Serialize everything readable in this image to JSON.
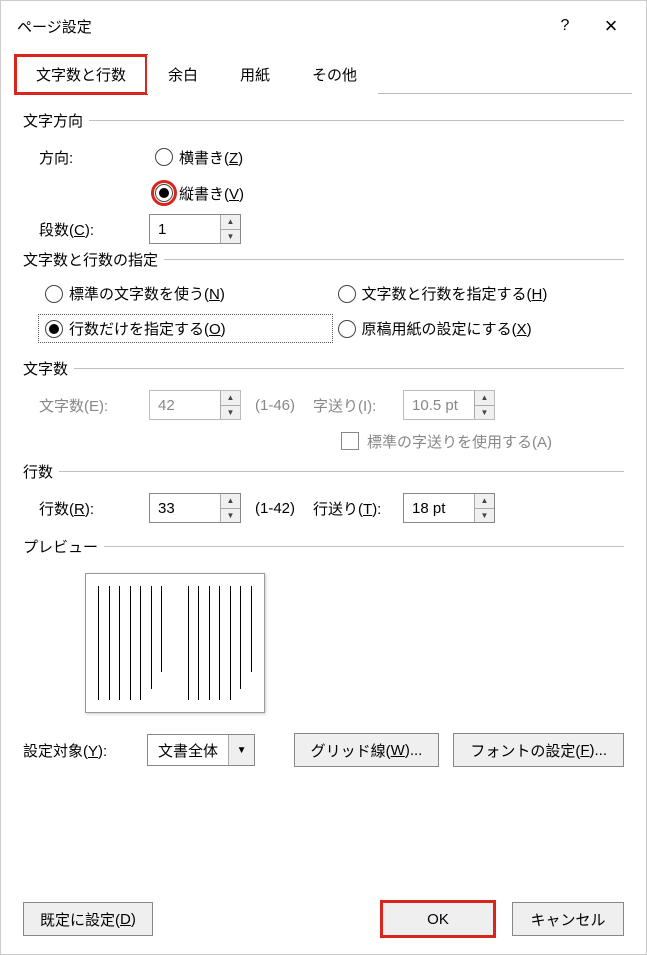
{
  "title": "ページ設定",
  "titlebar": {
    "help": "?",
    "close": "×"
  },
  "tabs": [
    {
      "label": "文字数と行数",
      "active": true,
      "highlighted": true
    },
    {
      "label": "余白",
      "active": false
    },
    {
      "label": "用紙",
      "active": false
    },
    {
      "label": "その他",
      "active": false
    }
  ],
  "direction": {
    "group": "文字方向",
    "label": "方向:",
    "horizontal": {
      "text": "横書き(",
      "key": "Z",
      "after": ")",
      "selected": false
    },
    "vertical": {
      "text": "縦書き(",
      "key": "V",
      "after": ")",
      "selected": true,
      "highlighted": true
    }
  },
  "columns": {
    "label_pre": "段数(",
    "key": "C",
    "label_post": "):",
    "value": "1"
  },
  "spec": {
    "group": "文字数と行数の指定",
    "opts": {
      "standard": {
        "text": "標準の文字数を使う(",
        "key": "N",
        "after": ")",
        "selected": false
      },
      "specify_both": {
        "text": "文字数と行数を指定する(",
        "key": "H",
        "after": ")",
        "selected": false
      },
      "lines_only": {
        "text": "行数だけを指定する(",
        "key": "O",
        "after": ")",
        "selected": true
      },
      "manuscript": {
        "text": "原稿用紙の設定にする(",
        "key": "X",
        "after": ")",
        "selected": false
      }
    }
  },
  "chars": {
    "group": "文字数",
    "count": {
      "label": "文字数(E):",
      "value": "42",
      "range": "(1-46)",
      "disabled": true
    },
    "pitch": {
      "label": "字送り(I):",
      "value": "10.5 pt",
      "disabled": true
    },
    "std_pitch": {
      "label": "標準の字送りを使用する(A)",
      "disabled": true
    }
  },
  "lines": {
    "group": "行数",
    "count": {
      "label_pre": "行数(",
      "key": "R",
      "label_post": "):",
      "value": "33",
      "range": "(1-42)"
    },
    "pitch": {
      "label_pre": "行送り(",
      "key": "T",
      "label_post": "):",
      "value": "18 pt"
    }
  },
  "preview": {
    "group": "プレビュー"
  },
  "bottom": {
    "apply_to": {
      "label_pre": "設定対象(",
      "key": "Y",
      "label_post": "):",
      "value": "文書全体"
    },
    "grid": {
      "label_pre": "グリッド線(",
      "key": "W",
      "label_post": ")..."
    },
    "font": {
      "label_pre": "フォントの設定(",
      "key": "F",
      "label_post": ")..."
    }
  },
  "footer": {
    "default": {
      "label_pre": "既定に設定(",
      "key": "D",
      "label_post": ")"
    },
    "ok": "OK",
    "cancel": "キャンセル"
  }
}
